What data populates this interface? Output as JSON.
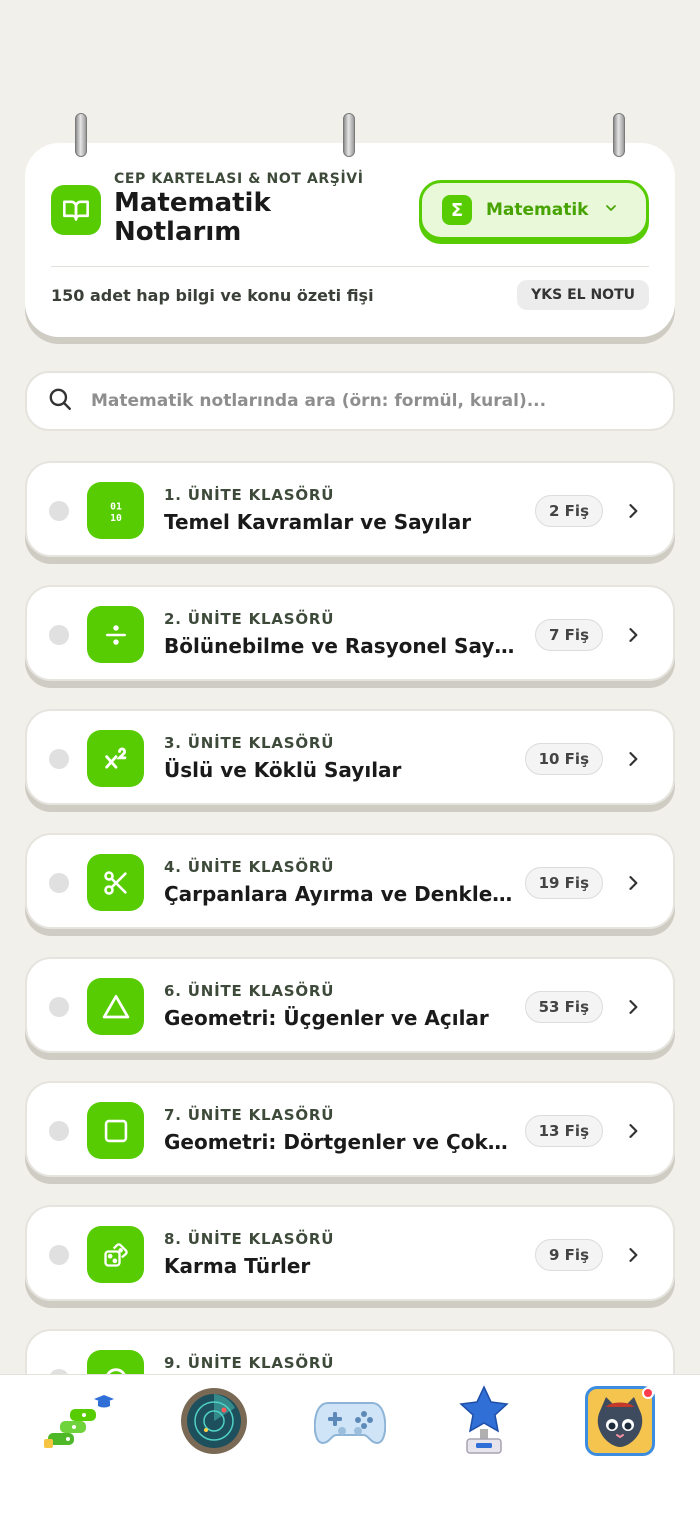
{
  "header": {
    "kicker": "CEP KARTELASI & NOT ARŞİVİ",
    "title": "Matematik Notlarım",
    "subject_label": "Matematik",
    "subject_icon": "sigma-icon",
    "summary": "150 adet hap bilgi ve konu özeti fişi",
    "badge": "YKS EL NOTU"
  },
  "search": {
    "placeholder": "Matematik notlarında ara (örn: formül, kural)..."
  },
  "units": [
    {
      "kicker": "1. ÜNİTE KLASÖRÜ",
      "title": "Temel Kavramlar ve Sayılar",
      "count": "2 Fiş",
      "icon": "binary-icon"
    },
    {
      "kicker": "2. ÜNİTE KLASÖRÜ",
      "title": "Bölünebilme ve Rasyonel Sayılar",
      "count": "7 Fiş",
      "icon": "divide-icon"
    },
    {
      "kicker": "3. ÜNİTE KLASÖRÜ",
      "title": "Üslü ve Köklü Sayılar",
      "count": "10 Fiş",
      "icon": "exponent-icon"
    },
    {
      "kicker": "4. ÜNİTE KLASÖRÜ",
      "title": "Çarpanlara Ayırma ve Denklemler",
      "count": "19 Fiş",
      "icon": "scissors-icon"
    },
    {
      "kicker": "6. ÜNİTE KLASÖRÜ",
      "title": "Geometri: Üçgenler ve Açılar",
      "count": "53 Fiş",
      "icon": "triangle-icon"
    },
    {
      "kicker": "7. ÜNİTE KLASÖRÜ",
      "title": "Geometri: Dörtgenler ve Çokgenler",
      "count": "13 Fiş",
      "icon": "square-icon"
    },
    {
      "kicker": "8. ÜNİTE KLASÖRÜ",
      "title": "Karma Türler",
      "count": "9 Fiş",
      "icon": "dice-icon"
    },
    {
      "kicker": "9. ÜNİTE KLASÖRÜ",
      "title": "",
      "count": "",
      "icon": "circle-icon"
    }
  ],
  "bottom_nav": [
    {
      "name": "learning-path-icon"
    },
    {
      "name": "radar-icon"
    },
    {
      "name": "gamepad-icon"
    },
    {
      "name": "trophy-star-icon"
    },
    {
      "name": "profile-cat-avatar",
      "has_notification": true
    }
  ],
  "colors": {
    "accent": "#58CC02",
    "accent_dark": "#46A302",
    "background": "#F2F0EA",
    "notification": "#FF3B4E"
  }
}
